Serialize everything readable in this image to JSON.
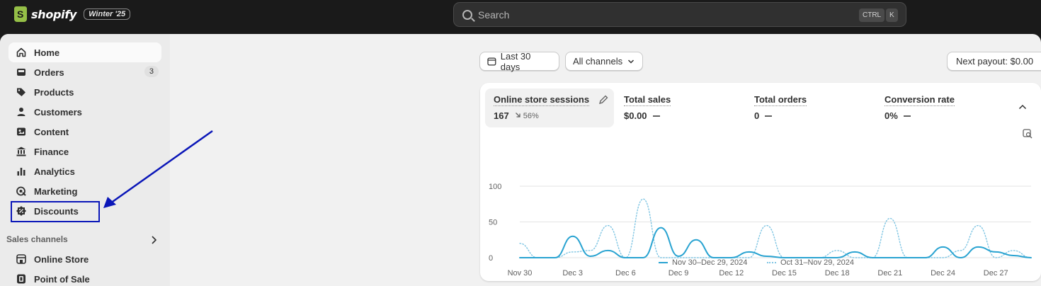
{
  "header": {
    "brand": "shopify",
    "edition_badge": "Winter '25",
    "search": {
      "placeholder": "Search",
      "shortcut_ctrl": "CTRL",
      "shortcut_key": "K"
    }
  },
  "sidebar": {
    "items": [
      {
        "label": "Home",
        "icon": "home-icon",
        "active": true
      },
      {
        "label": "Orders",
        "icon": "inbox-icon",
        "count": "3"
      },
      {
        "label": "Products",
        "icon": "tag-icon"
      },
      {
        "label": "Customers",
        "icon": "person-icon"
      },
      {
        "label": "Content",
        "icon": "image-icon"
      },
      {
        "label": "Finance",
        "icon": "bank-icon"
      },
      {
        "label": "Analytics",
        "icon": "bar-chart-icon"
      },
      {
        "label": "Marketing",
        "icon": "target-icon"
      },
      {
        "label": "Discounts",
        "icon": "discount-icon"
      }
    ],
    "sales_channels_label": "Sales channels",
    "channels": [
      {
        "label": "Online Store",
        "icon": "store-icon"
      },
      {
        "label": "Point of Sale",
        "icon": "pos-icon"
      }
    ]
  },
  "filters": {
    "date_range": "Last 30 days",
    "channels": "All channels",
    "payout": "Next payout: $0.00"
  },
  "metrics": [
    {
      "label": "Online store sessions",
      "value": "167",
      "change": "56%"
    },
    {
      "label": "Total sales",
      "value": "$0.00"
    },
    {
      "label": "Total orders",
      "value": "0"
    },
    {
      "label": "Conversion rate",
      "value": "0%"
    }
  ],
  "colors": {
    "accent": "#29a3d1",
    "annotation": "#0a16b8",
    "topbar": "#1a1a1a"
  },
  "chart_data": {
    "type": "line",
    "x": [
      "Nov 30",
      "Dec 1",
      "Dec 2",
      "Dec 3",
      "Dec 4",
      "Dec 5",
      "Dec 6",
      "Dec 7",
      "Dec 8",
      "Dec 9",
      "Dec 10",
      "Dec 11",
      "Dec 12",
      "Dec 13",
      "Dec 14",
      "Dec 15",
      "Dec 16",
      "Dec 17",
      "Dec 18",
      "Dec 19",
      "Dec 20",
      "Dec 21",
      "Dec 22",
      "Dec 23",
      "Dec 24",
      "Dec 25",
      "Dec 26",
      "Dec 27",
      "Dec 28",
      "Dec 29"
    ],
    "xticks": [
      "Nov 30",
      "Dec 3",
      "Dec 6",
      "Dec 9",
      "Dec 12",
      "Dec 15",
      "Dec 18",
      "Dec 21",
      "Dec 24",
      "Dec 27"
    ],
    "yticks": [
      0,
      50,
      100
    ],
    "ylim": [
      0,
      100
    ],
    "series": [
      {
        "name": "Nov 30–Dec 29, 2024",
        "style": "solid",
        "values": [
          0,
          0,
          0,
          30,
          2,
          10,
          0,
          0,
          42,
          2,
          25,
          0,
          0,
          8,
          2,
          0,
          0,
          0,
          0,
          8,
          0,
          0,
          0,
          0,
          15,
          0,
          15,
          8,
          3,
          0
        ]
      },
      {
        "name": "Oct 31–Nov 29, 2024",
        "style": "dotted",
        "values": [
          20,
          0,
          0,
          8,
          10,
          45,
          0,
          82,
          0,
          0,
          0,
          0,
          0,
          0,
          45,
          0,
          0,
          0,
          10,
          0,
          0,
          55,
          0,
          0,
          0,
          10,
          45,
          0,
          10,
          0
        ]
      }
    ]
  }
}
